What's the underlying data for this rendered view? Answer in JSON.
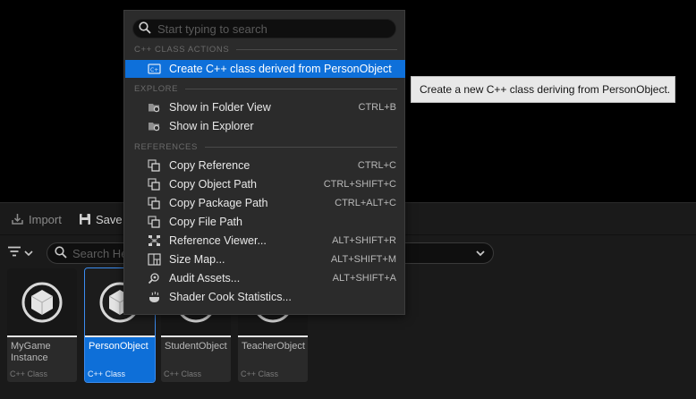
{
  "toolbar": {
    "import_label": "Import",
    "save_label": "Save"
  },
  "content_search": {
    "placeholder": "Search He"
  },
  "assets": [
    {
      "name": "MyGame Instance",
      "type": "C++ Class",
      "selected": false
    },
    {
      "name": "PersonObject",
      "type": "C++ Class",
      "selected": true
    },
    {
      "name": "StudentObject",
      "type": "C++ Class",
      "selected": false
    },
    {
      "name": "TeacherObject",
      "type": "C++ Class",
      "selected": false
    }
  ],
  "menu": {
    "search_placeholder": "Start typing to search",
    "sections": {
      "cpp": "C++ CLASS ACTIONS",
      "explore": "EXPLORE",
      "references": "REFERENCES"
    },
    "items": {
      "create_cpp": {
        "label": "Create C++ class derived from PersonObject",
        "icon": "cpp-class-icon"
      },
      "show_folder": {
        "label": "Show in Folder View",
        "shortcut": "CTRL+B",
        "icon": "folder-search-icon"
      },
      "show_explorer": {
        "label": "Show in Explorer",
        "icon": "folder-search-icon"
      },
      "copy_reference": {
        "label": "Copy Reference",
        "shortcut": "CTRL+C",
        "icon": "copy-icon"
      },
      "copy_object_path": {
        "label": "Copy Object Path",
        "shortcut": "CTRL+SHIFT+C",
        "icon": "copy-icon"
      },
      "copy_package_path": {
        "label": "Copy Package Path",
        "shortcut": "CTRL+ALT+C",
        "icon": "copy-icon"
      },
      "copy_file_path": {
        "label": "Copy File Path",
        "icon": "copy-icon"
      },
      "reference_viewer": {
        "label": "Reference Viewer...",
        "shortcut": "ALT+SHIFT+R",
        "icon": "reference-viewer-icon"
      },
      "size_map": {
        "label": "Size Map...",
        "shortcut": "ALT+SHIFT+M",
        "icon": "size-map-icon"
      },
      "audit_assets": {
        "label": "Audit Assets...",
        "shortcut": "ALT+SHIFT+A",
        "icon": "audit-icon"
      },
      "shader_cook": {
        "label": "Shader Cook Statistics...",
        "icon": "shader-cook-icon"
      }
    }
  },
  "tooltip": {
    "text": "Create a new C++ class deriving from PersonObject."
  },
  "colors": {
    "accent": "#0e70da",
    "menu_bg": "#2b2b2b",
    "panel_bg": "#1a1a1a",
    "tooltip_bg": "#e8e8e8"
  }
}
